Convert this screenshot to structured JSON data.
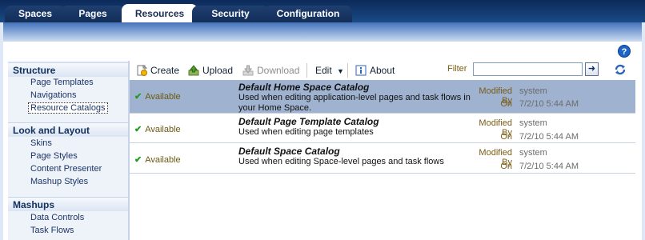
{
  "tabs": [
    {
      "label": "Spaces",
      "active": false
    },
    {
      "label": "Pages",
      "active": false
    },
    {
      "label": "Resources",
      "active": true
    },
    {
      "label": "Security",
      "active": false
    },
    {
      "label": "Configuration",
      "active": false
    }
  ],
  "help_label": "?",
  "sidebar": {
    "sections": [
      {
        "title": "Structure",
        "items": [
          "Page Templates",
          "Navigations",
          "Resource Catalogs"
        ]
      },
      {
        "title": "Look and Layout",
        "items": [
          "Skins",
          "Page Styles",
          "Content Presenter",
          "Mashup Styles"
        ]
      },
      {
        "title": "Mashups",
        "items": [
          "Data Controls",
          "Task Flows"
        ]
      }
    ],
    "selected": "Resource Catalogs"
  },
  "toolbar": {
    "create_label": "Create",
    "upload_label": "Upload",
    "download_label": "Download",
    "edit_label": "Edit",
    "about_label": "About",
    "filter_label": "Filter",
    "filter_value": "",
    "go_label": "➜"
  },
  "catalogs": [
    {
      "status": "Available",
      "title": "Default Home Space Catalog",
      "description": "Used when editing application-level pages and task flows in your Home Space.",
      "modified_by_label": "Modified By",
      "modified_by": "system",
      "on_label": "On",
      "on": "7/2/10 5:44 AM",
      "selected": true
    },
    {
      "status": "Available",
      "title": "Default Page Template Catalog",
      "description": "Used when editing page templates",
      "modified_by_label": "Modified By",
      "modified_by": "system",
      "on_label": "On",
      "on": "7/2/10 5:44 AM",
      "selected": false
    },
    {
      "status": "Available",
      "title": "Default Space Catalog",
      "description": "Used when editing Space-level pages and task flows",
      "modified_by_label": "Modified By",
      "modified_by": "system",
      "on_label": "On",
      "on": "7/2/10 5:44 AM",
      "selected": false
    }
  ]
}
